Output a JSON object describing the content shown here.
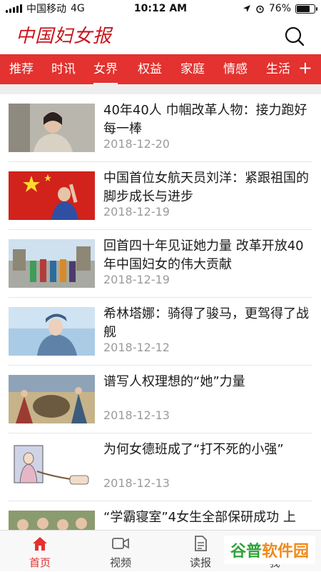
{
  "status_bar": {
    "carrier": "中国移动",
    "network": "4G",
    "time": "10:12 AM",
    "battery": "76%",
    "battery_level": 0.76
  },
  "header": {
    "logo_text": "中国妇女报",
    "search_icon": "search-icon"
  },
  "tabs": [
    {
      "label": "推荐",
      "active": false
    },
    {
      "label": "时讯",
      "active": false
    },
    {
      "label": "女界",
      "active": true
    },
    {
      "label": "权益",
      "active": false
    },
    {
      "label": "家庭",
      "active": false
    },
    {
      "label": "情感",
      "active": false
    },
    {
      "label": "生活",
      "active": false
    }
  ],
  "tab_add_label": "+",
  "news": [
    {
      "title": "40年40人 巾帼改革人物：接力跑好每一棒",
      "date": "2018-12-20"
    },
    {
      "title": "中国首位女航天员刘洋：紧跟祖国的脚步成长与进步",
      "date": "2018-12-19"
    },
    {
      "title": "回首四十年见证她力量 改革开放40年中国妇女的伟大贡献",
      "date": "2018-12-19"
    },
    {
      "title": "希林塔娜：骑得了骏马，更驾得了战舰",
      "date": "2018-12-12"
    },
    {
      "title": "谱写人权理想的“她”力量",
      "date": "2018-12-13"
    },
    {
      "title": "为何女德班成了“打不死的小强”",
      "date": "2018-12-13"
    },
    {
      "title": "“学霸寝室”4女生全部保研成功 上",
      "date": ""
    }
  ],
  "bottom_nav": [
    {
      "label": "首页",
      "icon": "home-icon",
      "active": true
    },
    {
      "label": "视频",
      "icon": "video-icon",
      "active": false
    },
    {
      "label": "读报",
      "icon": "newspaper-icon",
      "active": false
    },
    {
      "label": "我",
      "icon": "user-icon",
      "active": false
    }
  ],
  "watermark": {
    "part_a": "谷普",
    "part_b": "软件园"
  },
  "colors": {
    "brand_red": "#e3322f",
    "logo_red": "#c8161d",
    "date_gray": "#9b9b9b"
  }
}
